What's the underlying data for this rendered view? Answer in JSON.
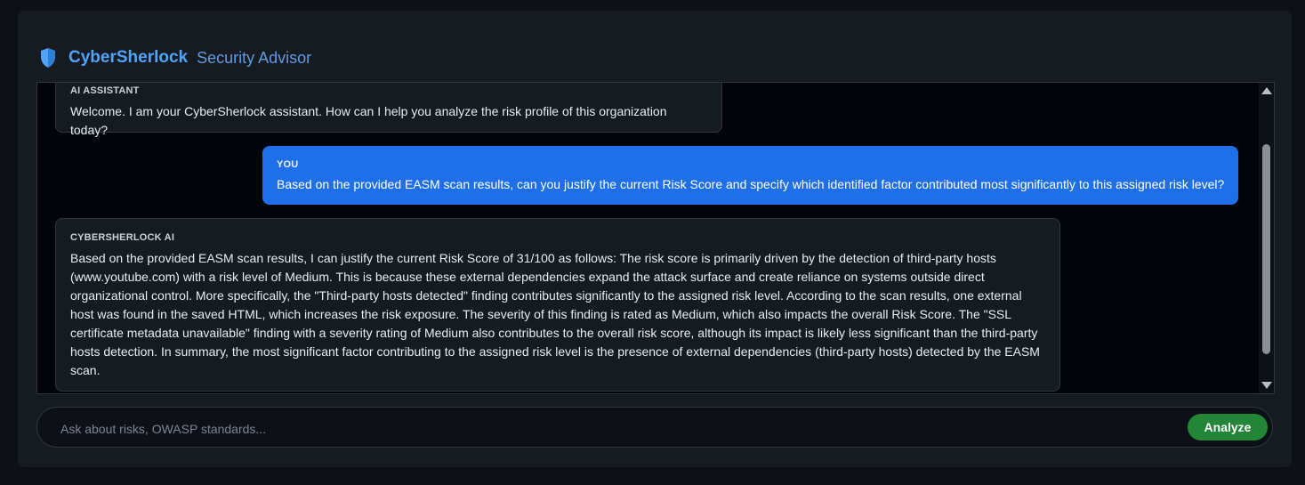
{
  "header": {
    "brand": "CyberSherlock",
    "subtitle": "Security Advisor",
    "icon": "shield-icon",
    "brand_color": "#4fa3ff"
  },
  "messages": [
    {
      "role": "assistant",
      "author": "AI ASSISTANT",
      "text": "Welcome. I am your CyberSherlock assistant. How can I help you analyze the risk profile of this organization today?"
    },
    {
      "role": "user",
      "author": "YOU",
      "text": "Based on the provided EASM scan results, can you justify the current Risk Score and specify which identified factor contributed most significantly to this assigned risk level?"
    },
    {
      "role": "assistant",
      "author": "CYBERSHERLOCK AI",
      "text": "Based on the provided EASM scan results, I can justify the current Risk Score of 31/100 as follows: The risk score is primarily driven by the detection of third-party hosts (www.youtube.com) with a risk level of Medium. This is because these external dependencies expand the attack surface and create reliance on systems outside direct organizational control. More specifically, the \"Third-party hosts detected\" finding contributes significantly to the assigned risk level. According to the scan results, one external host was found in the saved HTML, which increases the risk exposure. The severity of this finding is rated as Medium, which also impacts the overall Risk Score. The \"SSL certificate metadata unavailable\" finding with a severity rating of Medium also contributes to the overall risk score, although its impact is likely less significant than the third-party hosts detection. In summary, the most significant factor contributing to the assigned risk level is the presence of external dependencies (third-party hosts) detected by the EASM scan."
    }
  ],
  "composer": {
    "placeholder": "Ask about risks, OWASP standards...",
    "value": "",
    "button_label": "Analyze",
    "button_color": "#238636"
  },
  "colors": {
    "user_bubble": "#1f6feb",
    "assistant_bubble": "#161b22",
    "background": "#0d1117"
  }
}
